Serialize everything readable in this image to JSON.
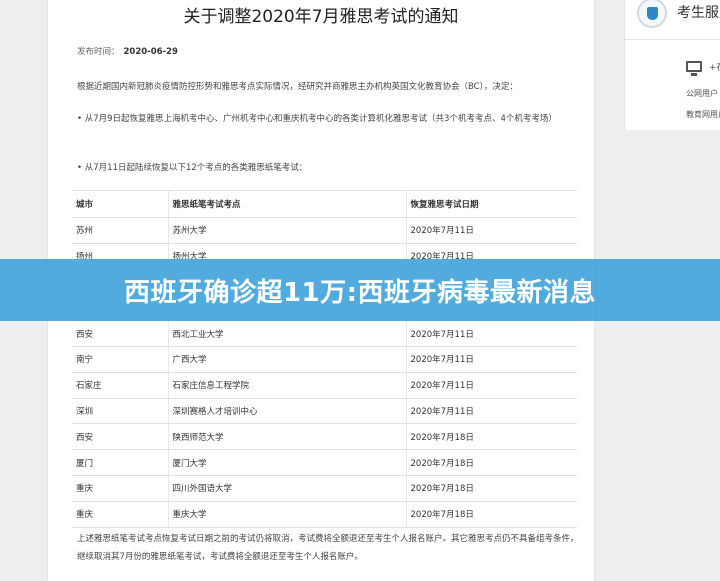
{
  "article": {
    "title": "关于调整2020年7月雅思考试的通知",
    "publish_label": "发布时间：",
    "publish_date": "2020-06-29",
    "intro": "根据近期国内新冠肺炎疫情防控形势和雅思考点实际情况，经研究并商雅思主办机构英国文化教育协会（BC），决定：",
    "bullet1": "• 从7月9日起恢复雅思上海机考中心、广州机考中心和重庆机考中心的各类计算机化雅思考试（共3个机考考点、4个机考考场）",
    "bullet2": "• 从7月11日起陆续恢复以下12个考点的各类雅思纸笔考试：",
    "table": {
      "headers": [
        "城市",
        "雅思纸笔考试考点",
        "恢复雅思考试日期"
      ],
      "rows": [
        [
          "苏州",
          "苏州大学",
          "2020年7月11日"
        ],
        [
          "扬州",
          "扬州大学",
          "2020年7月11日"
        ],
        [
          "",
          "",
          ""
        ],
        [
          "",
          "",
          ""
        ],
        [
          "西安",
          "西北工业大学",
          "2020年7月11日"
        ],
        [
          "南宁",
          "广西大学",
          "2020年7月11日"
        ],
        [
          "石家庄",
          "石家庄信息工程学院",
          "2020年7月11日"
        ],
        [
          "深圳",
          "深圳赛格人才培训中心",
          "2020年7月11日"
        ],
        [
          "西安",
          "陕西师范大学",
          "2020年7月18日"
        ],
        [
          "厦门",
          "厦门大学",
          "2020年7月18日"
        ],
        [
          "重庆",
          "四川外国语大学",
          "2020年7月18日"
        ],
        [
          "重庆",
          "重庆大学",
          "2020年7月18日"
        ]
      ]
    },
    "footer": "上述雅思纸笔考试考点恢复考试日期之前的考试仍将取消，考试费将全额退还至考生个人报名账户。其它雅思考点仍不具备组考条件，继续取消其7月份的雅思纸笔考试，考试费将全额退还至考生个人报名账户。"
  },
  "sidebar": {
    "card_title": "考生服",
    "icon": "shield-icon",
    "plus_text": "+在",
    "lines": [
      "公网用户",
      "教育网用户"
    ]
  },
  "banner": {
    "text": "西班牙确诊超11万:西班牙病毒最新消息"
  },
  "colors": {
    "banner": "#44a5dc",
    "accent": "#2f87c5"
  }
}
